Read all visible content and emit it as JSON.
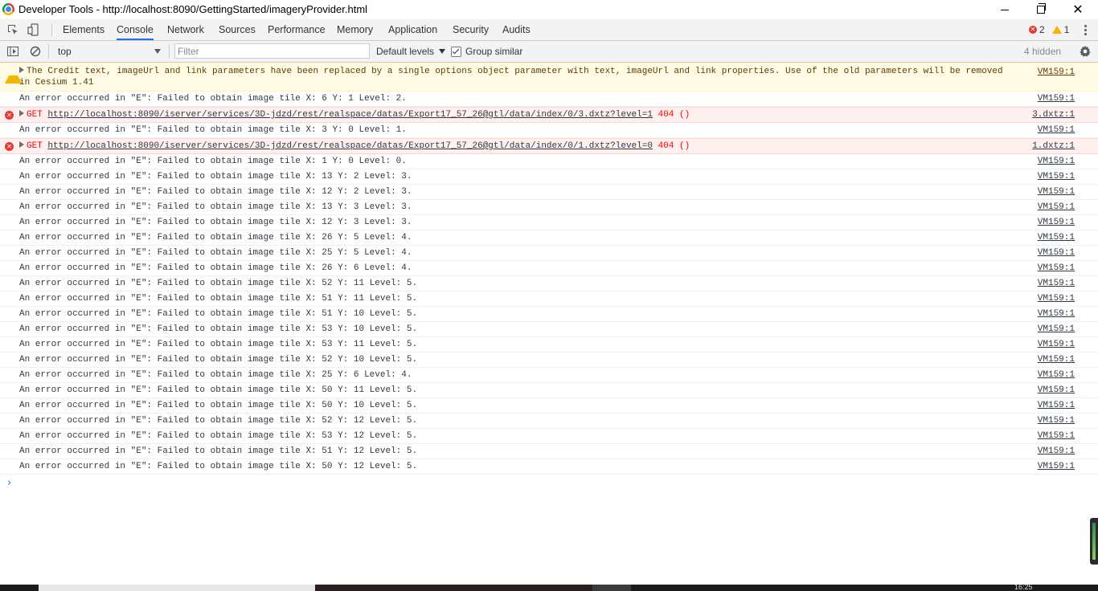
{
  "window": {
    "title": "Developer Tools - http://localhost:8090/GettingStarted/imageryProvider.html",
    "controls": {
      "minimize": "minimize",
      "maximize": "restore",
      "close": "✕"
    }
  },
  "tabs": [
    "Elements",
    "Console",
    "Network",
    "Sources",
    "Performance",
    "Memory",
    "Application",
    "Security",
    "Audits"
  ],
  "active_tab": "Console",
  "counters": {
    "errors": "2",
    "warnings": "1"
  },
  "console_toolbar": {
    "context": "top",
    "filter_placeholder": "Filter",
    "levels": "Default levels",
    "group_similar": "Group similar",
    "group_similar_checked": true,
    "hidden": "4 hidden"
  },
  "messages": [
    {
      "type": "warn",
      "text": "The Credit text, imageUrl and link parameters have been replaced by a single options object parameter with text, imageUrl and link properties. Use of the old parameters will be removed in Cesium 1.41",
      "source": "VM159:1"
    },
    {
      "type": "log",
      "text": "An error occurred in \"E\": Failed to obtain image tile X: 6 Y: 1 Level: 2.",
      "source": "VM159:1"
    },
    {
      "type": "err",
      "method": "GET",
      "url": "http://localhost:8090/iserver/services/3D-jdzd/rest/realspace/datas/Export17_57_26@gtl/data/index/0/3.dxtz?level=1",
      "status": "404 ()",
      "source": "3.dxtz:1"
    },
    {
      "type": "log",
      "text": "An error occurred in \"E\": Failed to obtain image tile X: 3 Y: 0 Level: 1.",
      "source": "VM159:1"
    },
    {
      "type": "err",
      "method": "GET",
      "url": "http://localhost:8090/iserver/services/3D-jdzd/rest/realspace/datas/Export17_57_26@gtl/data/index/0/1.dxtz?level=0",
      "status": "404 ()",
      "source": "1.dxtz:1"
    },
    {
      "type": "log",
      "text": "An error occurred in \"E\": Failed to obtain image tile X: 1 Y: 0 Level: 0.",
      "source": "VM159:1"
    },
    {
      "type": "log",
      "text": "An error occurred in \"E\": Failed to obtain image tile X: 13 Y: 2 Level: 3.",
      "source": "VM159:1"
    },
    {
      "type": "log",
      "text": "An error occurred in \"E\": Failed to obtain image tile X: 12 Y: 2 Level: 3.",
      "source": "VM159:1"
    },
    {
      "type": "log",
      "text": "An error occurred in \"E\": Failed to obtain image tile X: 13 Y: 3 Level: 3.",
      "source": "VM159:1"
    },
    {
      "type": "log",
      "text": "An error occurred in \"E\": Failed to obtain image tile X: 12 Y: 3 Level: 3.",
      "source": "VM159:1"
    },
    {
      "type": "log",
      "text": "An error occurred in \"E\": Failed to obtain image tile X: 26 Y: 5 Level: 4.",
      "source": "VM159:1"
    },
    {
      "type": "log",
      "text": "An error occurred in \"E\": Failed to obtain image tile X: 25 Y: 5 Level: 4.",
      "source": "VM159:1"
    },
    {
      "type": "log",
      "text": "An error occurred in \"E\": Failed to obtain image tile X: 26 Y: 6 Level: 4.",
      "source": "VM159:1"
    },
    {
      "type": "log",
      "text": "An error occurred in \"E\": Failed to obtain image tile X: 52 Y: 11 Level: 5.",
      "source": "VM159:1"
    },
    {
      "type": "log",
      "text": "An error occurred in \"E\": Failed to obtain image tile X: 51 Y: 11 Level: 5.",
      "source": "VM159:1"
    },
    {
      "type": "log",
      "text": "An error occurred in \"E\": Failed to obtain image tile X: 51 Y: 10 Level: 5.",
      "source": "VM159:1"
    },
    {
      "type": "log",
      "text": "An error occurred in \"E\": Failed to obtain image tile X: 53 Y: 10 Level: 5.",
      "source": "VM159:1"
    },
    {
      "type": "log",
      "text": "An error occurred in \"E\": Failed to obtain image tile X: 53 Y: 11 Level: 5.",
      "source": "VM159:1"
    },
    {
      "type": "log",
      "text": "An error occurred in \"E\": Failed to obtain image tile X: 52 Y: 10 Level: 5.",
      "source": "VM159:1"
    },
    {
      "type": "log",
      "text": "An error occurred in \"E\": Failed to obtain image tile X: 25 Y: 6 Level: 4.",
      "source": "VM159:1"
    },
    {
      "type": "log",
      "text": "An error occurred in \"E\": Failed to obtain image tile X: 50 Y: 11 Level: 5.",
      "source": "VM159:1"
    },
    {
      "type": "log",
      "text": "An error occurred in \"E\": Failed to obtain image tile X: 50 Y: 10 Level: 5.",
      "source": "VM159:1"
    },
    {
      "type": "log",
      "text": "An error occurred in \"E\": Failed to obtain image tile X: 52 Y: 12 Level: 5.",
      "source": "VM159:1"
    },
    {
      "type": "log",
      "text": "An error occurred in \"E\": Failed to obtain image tile X: 53 Y: 12 Level: 5.",
      "source": "VM159:1"
    },
    {
      "type": "log",
      "text": "An error occurred in \"E\": Failed to obtain image tile X: 51 Y: 12 Level: 5.",
      "source": "VM159:1"
    },
    {
      "type": "log",
      "text": "An error occurred in \"E\": Failed to obtain image tile X: 50 Y: 12 Level: 5.",
      "source": "VM159:1"
    }
  ],
  "prompt": "›",
  "taskbar": {
    "clock": "16:25"
  },
  "colors": {
    "accent": "#1a73e8",
    "error": "#ff0000",
    "warning_bg": "#fffbe5",
    "error_bg": "#fff0f0"
  },
  "icons": [
    "chrome-icon",
    "inspect-icon",
    "device-toolbar-icon",
    "sidebar-toggle-icon",
    "clear-console-icon",
    "error-icon",
    "warning-icon",
    "settings-gear-icon",
    "kebab-menu-icon",
    "expand-triangle-icon"
  ]
}
